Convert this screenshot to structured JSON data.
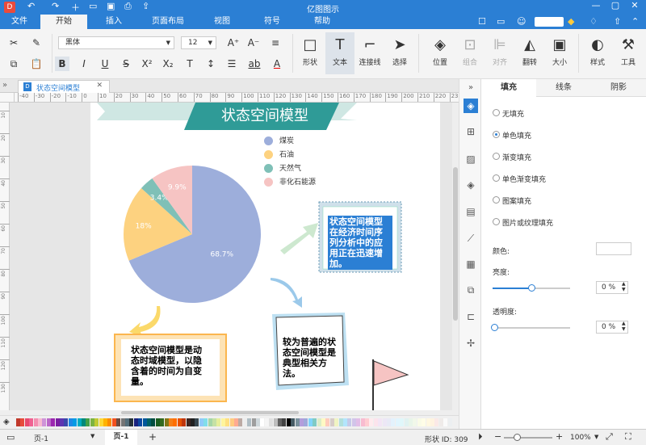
{
  "app": {
    "title": "亿图图示"
  },
  "menu": {
    "tabs": [
      "文件",
      "开始",
      "插入",
      "页面布局",
      "视图",
      "符号",
      "帮助"
    ],
    "active": "开始"
  },
  "ribbon": {
    "font_name": "黑体",
    "font_size": "12",
    "large_buttons": [
      "形状",
      "文本",
      "连接线",
      "选择",
      "位置",
      "组合",
      "对齐",
      "翻转",
      "大小",
      "样式",
      "工具"
    ]
  },
  "document": {
    "tab_title": "状态空间模型"
  },
  "ruler": {
    "h_ticks": [
      "-40",
      "-30",
      "-20",
      "-10",
      "0",
      "10",
      "20",
      "30",
      "40",
      "50",
      "60",
      "70",
      "80",
      "90",
      "100",
      "110",
      "120",
      "130",
      "140",
      "150",
      "160",
      "170",
      "180",
      "190",
      "200",
      "210",
      "220",
      "230"
    ],
    "v_ticks": [
      "10",
      "20",
      "30",
      "40",
      "50",
      "60",
      "70",
      "80",
      "90",
      "100",
      "110",
      "120",
      "130"
    ]
  },
  "canvas": {
    "banner_title": "状态空间模型",
    "chart": {
      "legend": [
        "煤炭",
        "石油",
        "天然气",
        "非化石能源"
      ],
      "slice_labels": [
        "68.7%",
        "18%",
        "3.4%",
        "9.9%"
      ],
      "colors": {
        "coal": "#9daedb",
        "oil": "#fdd280",
        "gas": "#7fc0b7",
        "nonfossil": "#f6c4c3"
      }
    },
    "box_right": "状态空间模型在经济时间序列分析中的应用正在迅速增加。",
    "box_left": "状态空间模型是动态时域模型，以隐含着的时间为自变量。",
    "box_middle": "较为普遍的状态空间模型是典型相关方法。"
  },
  "chart_data": {
    "type": "pie",
    "categories": [
      "煤炭",
      "石油",
      "天然气",
      "非化石能源"
    ],
    "values": [
      68.7,
      18,
      3.4,
      9.9
    ],
    "legend_position": "top-right"
  },
  "panel": {
    "tabs": [
      "填充",
      "线条",
      "阴影"
    ],
    "active_tab": "填充",
    "fill_options": [
      "无填充",
      "单色填充",
      "渐变填充",
      "单色渐变填充",
      "图案填充",
      "图片或纹理填充"
    ],
    "selected_option": "单色填充",
    "color_label": "颜色:",
    "brightness_label": "亮度:",
    "brightness_value": "0 %",
    "transparency_label": "透明度:",
    "transparency_value": "0 %"
  },
  "status": {
    "page_selector": "页-1",
    "page_tab": "页-1",
    "add_page": "+",
    "shape_id": "形状 ID: 309",
    "zoom": "100%"
  }
}
